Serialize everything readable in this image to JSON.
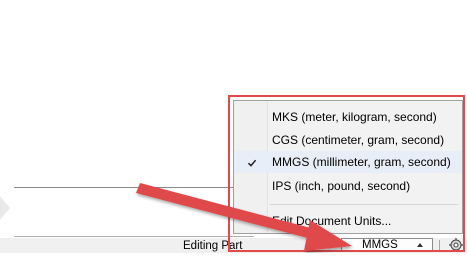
{
  "menu": {
    "items": [
      {
        "label": "MKS (meter, kilogram, second)",
        "checked": false
      },
      {
        "label": "CGS (centimeter, gram, second)",
        "checked": false
      },
      {
        "label": "MMGS (millimeter, gram, second)",
        "checked": true
      },
      {
        "label": "IPS (inch, pound, second)",
        "checked": false
      },
      {
        "label": "Edit Document Units...",
        "checked": false
      }
    ]
  },
  "status_bar": {
    "status_text": "Editing Part",
    "units_value": "MMGS",
    "settings_icon": "rebuild-gear-icon"
  },
  "annotation": {
    "highlight_color": "#e04a4a",
    "arrow_color": "#e04a4a"
  }
}
